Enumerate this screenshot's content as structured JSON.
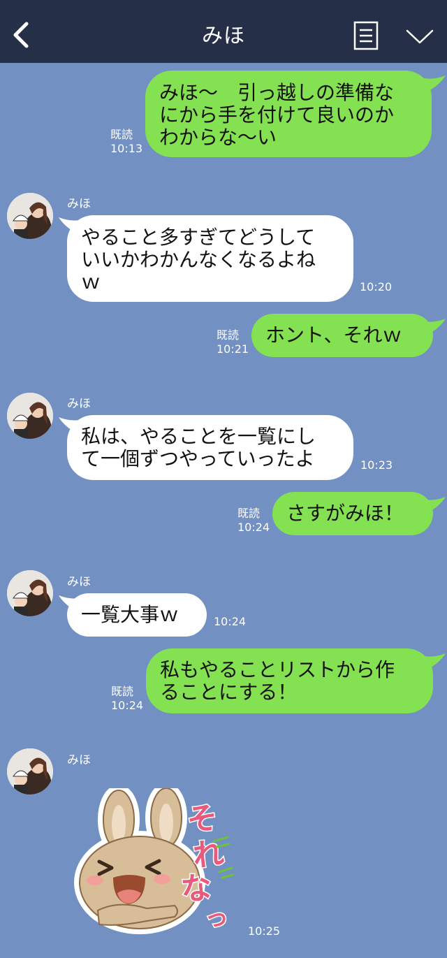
{
  "header": {
    "title": "みほ"
  },
  "messages": [
    {
      "text": "みほ〜　引っ越しの準備な\nにから手を付けて良いのか\nわからな〜い",
      "read": "既読",
      "time": "10:13"
    },
    {
      "sender": "みほ",
      "text": "やること多すぎてどうして\nいいかわかんなくなるよね\nｗ",
      "time": "10:20"
    },
    {
      "text": "ホント、それｗ",
      "read": "既読",
      "time": "10:21"
    },
    {
      "sender": "みほ",
      "text": "私は、やることを一覧にし\nて一個ずつやっていったよ",
      "time": "10:23"
    },
    {
      "text": "さすがみほ！",
      "read": "既読",
      "time": "10:24"
    },
    {
      "sender": "みほ",
      "text": "一覧大事ｗ",
      "time": "10:24"
    },
    {
      "text": "私もやることリストから作\nることにする！",
      "read": "既読",
      "time": "10:24"
    },
    {
      "sender": "みほ",
      "sticker": {
        "text": "それなっ",
        "icon": "bunny-sticker-icon"
      },
      "time": "10:25"
    }
  ]
}
